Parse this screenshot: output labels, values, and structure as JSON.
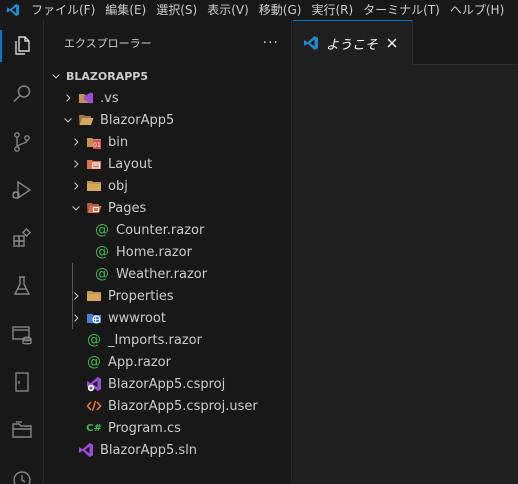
{
  "menu": {
    "items": [
      "ファイル(F)",
      "編集(E)",
      "選択(S)",
      "表示(V)",
      "移動(G)",
      "実行(R)",
      "ターミナル(T)",
      "ヘルプ(H)"
    ]
  },
  "activity_bar": {
    "icons": [
      "explorer-icon",
      "search-icon",
      "source-control-icon",
      "run-debug-icon",
      "extensions-icon",
      "testing-icon",
      "remote-explorer-icon",
      "bookmark-icon",
      "folder-icon",
      "timeline-icon"
    ]
  },
  "sidebar": {
    "title": "エクスプローラー",
    "more": "···",
    "root": "BLAZORAPP5"
  },
  "tree": [
    {
      "label": ".vs",
      "icon": "vs-folder-icon"
    },
    {
      "label": "BlazorApp5",
      "icon": "folder-open-icon"
    },
    {
      "label": "bin",
      "icon": "bin-folder-icon"
    },
    {
      "label": "Layout",
      "icon": "layout-folder-icon"
    },
    {
      "label": "obj",
      "icon": "folder-icon"
    },
    {
      "label": "Pages",
      "icon": "pages-folder-icon"
    },
    {
      "label": "Counter.razor",
      "icon": "razor-icon"
    },
    {
      "label": "Home.razor",
      "icon": "razor-icon"
    },
    {
      "label": "Weather.razor",
      "icon": "razor-icon"
    },
    {
      "label": "Properties",
      "icon": "folder-icon"
    },
    {
      "label": "wwwroot",
      "icon": "wwwroot-folder-icon"
    },
    {
      "label": "_Imports.razor",
      "icon": "razor-icon"
    },
    {
      "label": "App.razor",
      "icon": "razor-icon"
    },
    {
      "label": "BlazorApp5.csproj",
      "icon": "csproj-icon"
    },
    {
      "label": "BlazorApp5.csproj.user",
      "icon": "xml-icon"
    },
    {
      "label": "Program.cs",
      "icon": "csharp-icon",
      "glyph": "C#"
    },
    {
      "label": "BlazorApp5.sln",
      "icon": "solution-icon"
    }
  ],
  "editor": {
    "tab_label": "ようこそ"
  },
  "colors": {
    "accent": "#0078d4",
    "razor": "#3fb950",
    "csharp": "#3fb950",
    "folder": "#c09553",
    "vscode_blue": "#2489ca"
  }
}
